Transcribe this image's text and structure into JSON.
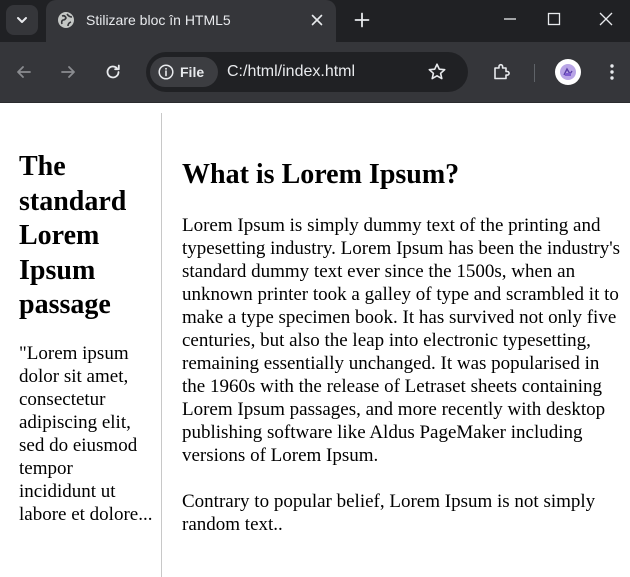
{
  "browser": {
    "tab": {
      "title": "Stilizare bloc în HTML5"
    },
    "address_bar": {
      "chip_label": "File",
      "url": "C:/html/index.html"
    },
    "icons": {
      "tab_search": "chevron-down-icon",
      "favicon": "globe-icon",
      "tab_close": "close-icon",
      "new_tab": "plus-icon",
      "minimize": "minimize-icon",
      "maximize": "maximize-icon",
      "close_window": "close-icon",
      "back": "arrow-left-icon",
      "forward": "arrow-right-icon",
      "reload": "reload-icon",
      "site_info": "info-icon",
      "bookmark": "star-icon",
      "extensions": "puzzle-icon",
      "profile": "avatar-icon",
      "menu": "kebab-menu-icon"
    },
    "colors": {
      "tabstrip": "#202124",
      "toolbar": "#35363a",
      "omnibox": "#202124",
      "text": "#e8eaed"
    }
  },
  "page": {
    "aside": {
      "heading": "The standard Lorem Ipsum passage",
      "text": "\"Lorem ipsum dolor sit amet, consectetur adipiscing elit, sed do eiusmod tempor incididunt ut labore et dolore..."
    },
    "main": {
      "heading": "What is Lorem Ipsum?",
      "paragraph_1": "Lorem Ipsum is simply dummy text of the printing and typesetting industry. Lorem Ipsum has been the industry's standard dummy text ever since the 1500s, when an unknown printer took a galley of type and scrambled it to make a type specimen book. It has survived not only five centuries, but also the leap into electronic typesetting, remaining essentially unchanged. It was popularised in the 1960s with the release of Letraset sheets containing Lorem Ipsum passages, and more recently with desktop publishing software like Aldus PageMaker including versions of Lorem Ipsum.",
      "paragraph_2": "Contrary to popular belief, Lorem Ipsum is not simply random text.."
    }
  }
}
